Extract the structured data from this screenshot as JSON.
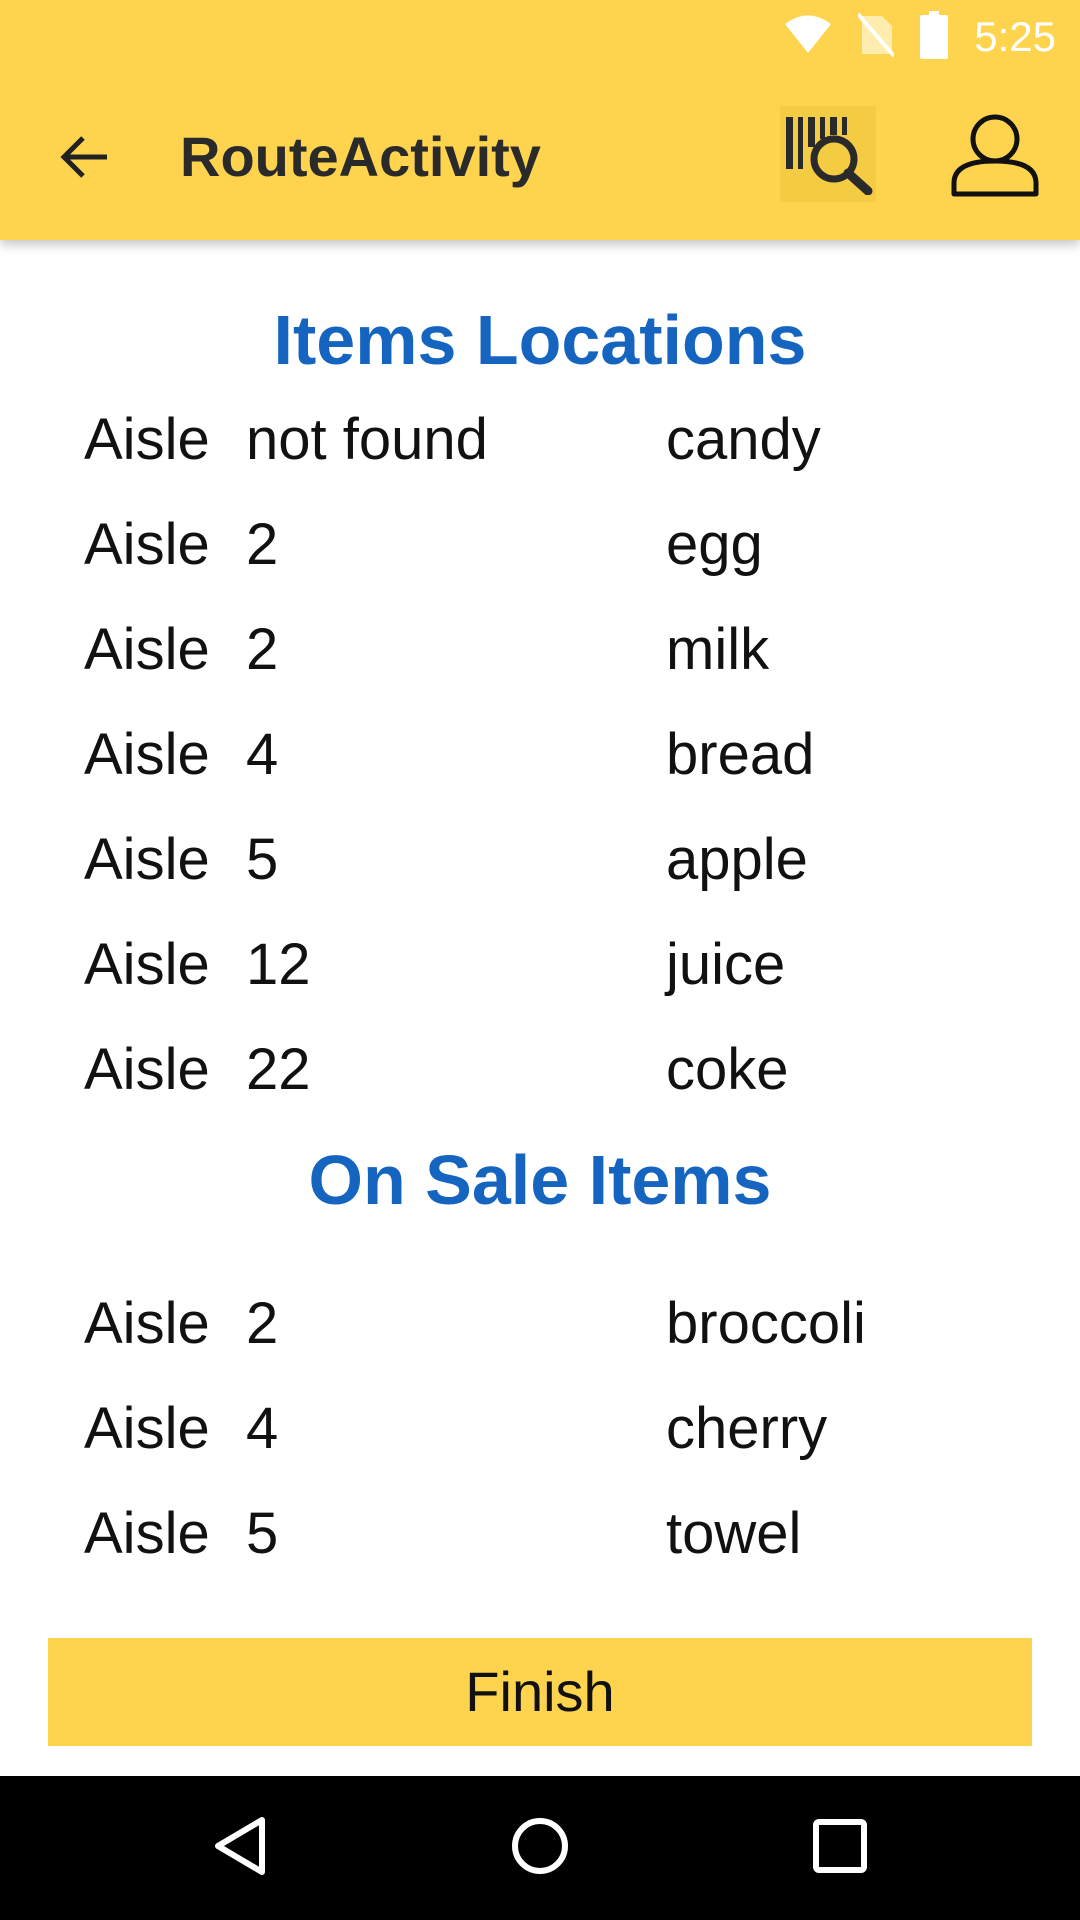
{
  "status_bar": {
    "time": "5:25",
    "icons": [
      "wifi-icon",
      "no-sim-icon",
      "battery-icon"
    ]
  },
  "toolbar": {
    "title": "RouteActivity",
    "back_icon": "arrow-back-icon",
    "scan_icon": "barcode-search-icon",
    "profile_icon": "person-icon"
  },
  "items_section": {
    "title": "Items Locations",
    "rows": [
      {
        "aisle_label": "Aisle",
        "aisle": "not found",
        "item": "candy"
      },
      {
        "aisle_label": "Aisle",
        "aisle": "2",
        "item": "egg"
      },
      {
        "aisle_label": "Aisle",
        "aisle": "2",
        "item": "milk"
      },
      {
        "aisle_label": "Aisle",
        "aisle": "4",
        "item": "bread"
      },
      {
        "aisle_label": "Aisle",
        "aisle": "5",
        "item": "apple"
      },
      {
        "aisle_label": "Aisle",
        "aisle": "12",
        "item": "juice"
      },
      {
        "aisle_label": "Aisle",
        "aisle": "22",
        "item": "coke"
      }
    ]
  },
  "sale_section": {
    "title": "On Sale Items",
    "rows": [
      {
        "aisle_label": "Aisle",
        "aisle": "2",
        "item": "broccoli"
      },
      {
        "aisle_label": "Aisle",
        "aisle": "4",
        "item": "cherry"
      },
      {
        "aisle_label": "Aisle",
        "aisle": "5",
        "item": "towel"
      }
    ]
  },
  "finish_button": {
    "label": "Finish"
  },
  "nav_bar": {
    "icons": [
      "nav-back-icon",
      "nav-home-icon",
      "nav-recents-icon"
    ]
  },
  "colors": {
    "accent_yellow": "#FED44E",
    "section_title_blue": "#1565C0",
    "nav_bar_black": "#000000"
  }
}
